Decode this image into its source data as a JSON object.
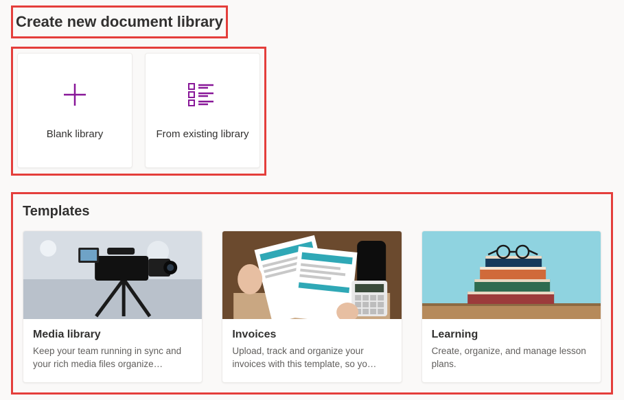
{
  "accent": "#881798",
  "header": {
    "title": "Create new document library"
  },
  "createOptions": [
    {
      "icon": "plus-icon",
      "label": "Blank library"
    },
    {
      "icon": "from-existing-icon",
      "label": "From existing library"
    }
  ],
  "templates": {
    "heading": "Templates",
    "items": [
      {
        "thumb": "media-thumb",
        "title": "Media library",
        "desc": "Keep your team running in sync and your rich media files organize…"
      },
      {
        "thumb": "invoices-thumb",
        "title": "Invoices",
        "desc": "Upload, track and organize your invoices with this template, so yo…"
      },
      {
        "thumb": "learning-thumb",
        "title": "Learning",
        "desc": "Create, organize, and manage lesson plans."
      }
    ]
  }
}
